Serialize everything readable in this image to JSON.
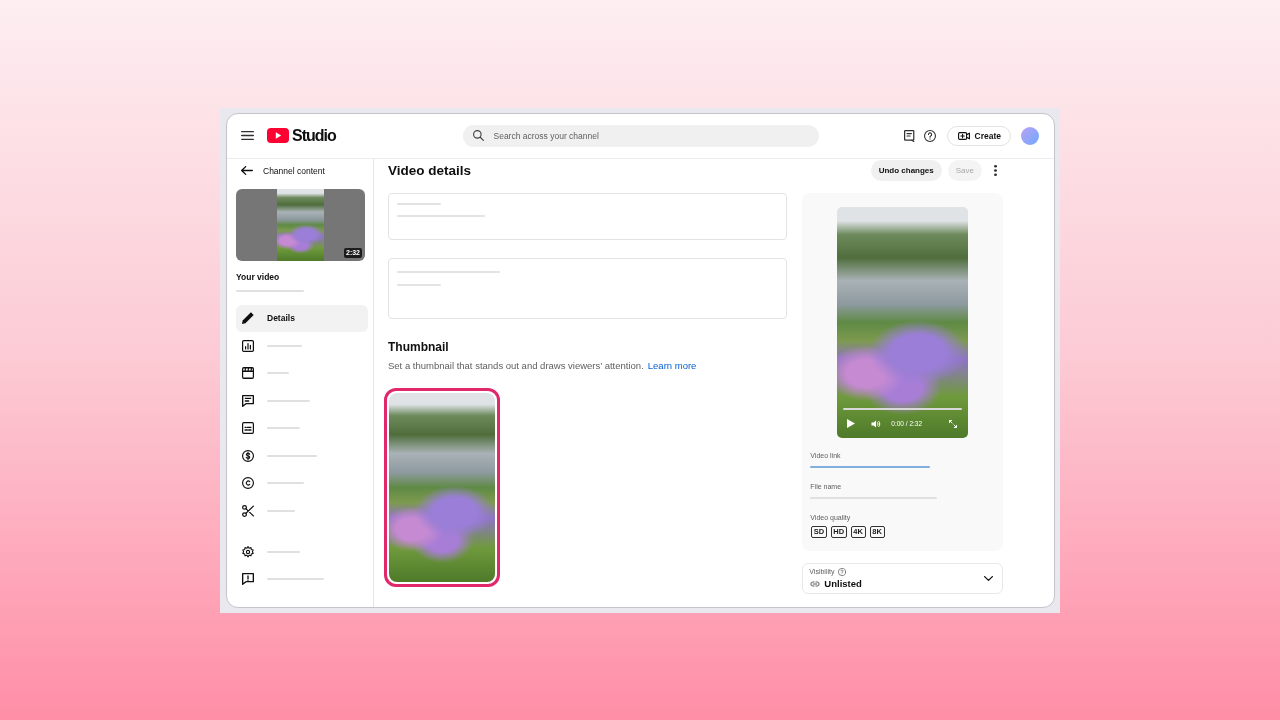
{
  "header": {
    "brand": "Studio",
    "search": {
      "placeholder": "Search across your channel"
    },
    "create_button": "Create"
  },
  "sidebar": {
    "back_link": "Channel content",
    "video": {
      "duration": "2:32",
      "heading": "Your video"
    },
    "items": [
      {
        "label": "Details",
        "selected": true
      },
      {
        "selected": false
      },
      {
        "selected": false
      },
      {
        "selected": false
      },
      {
        "selected": false
      },
      {
        "selected": false
      },
      {
        "selected": false
      },
      {
        "selected": false
      }
    ],
    "bottom_items": [
      {
        "selected": false
      },
      {
        "selected": false
      }
    ]
  },
  "main": {
    "title": "Video details",
    "undo_button": "Undo changes",
    "save_button": {
      "label": "Save",
      "disabled": true
    },
    "thumbnail_section": {
      "title": "Thumbnail",
      "description": "Set a thumbnail that stands out and draws viewers’ attention.",
      "learn_more_link": "Learn more",
      "thumbnails": [
        {
          "selected": true
        }
      ]
    },
    "preview": {
      "time": "0:00 / 2:32",
      "video_link_label": "Video link",
      "file_name_label": "File name",
      "quality_label": "Video quality",
      "qualities": [
        "SD",
        "HD",
        "4K",
        "8K"
      ]
    },
    "visibility": {
      "label": "Visibility",
      "value": "Unlisted"
    }
  }
}
